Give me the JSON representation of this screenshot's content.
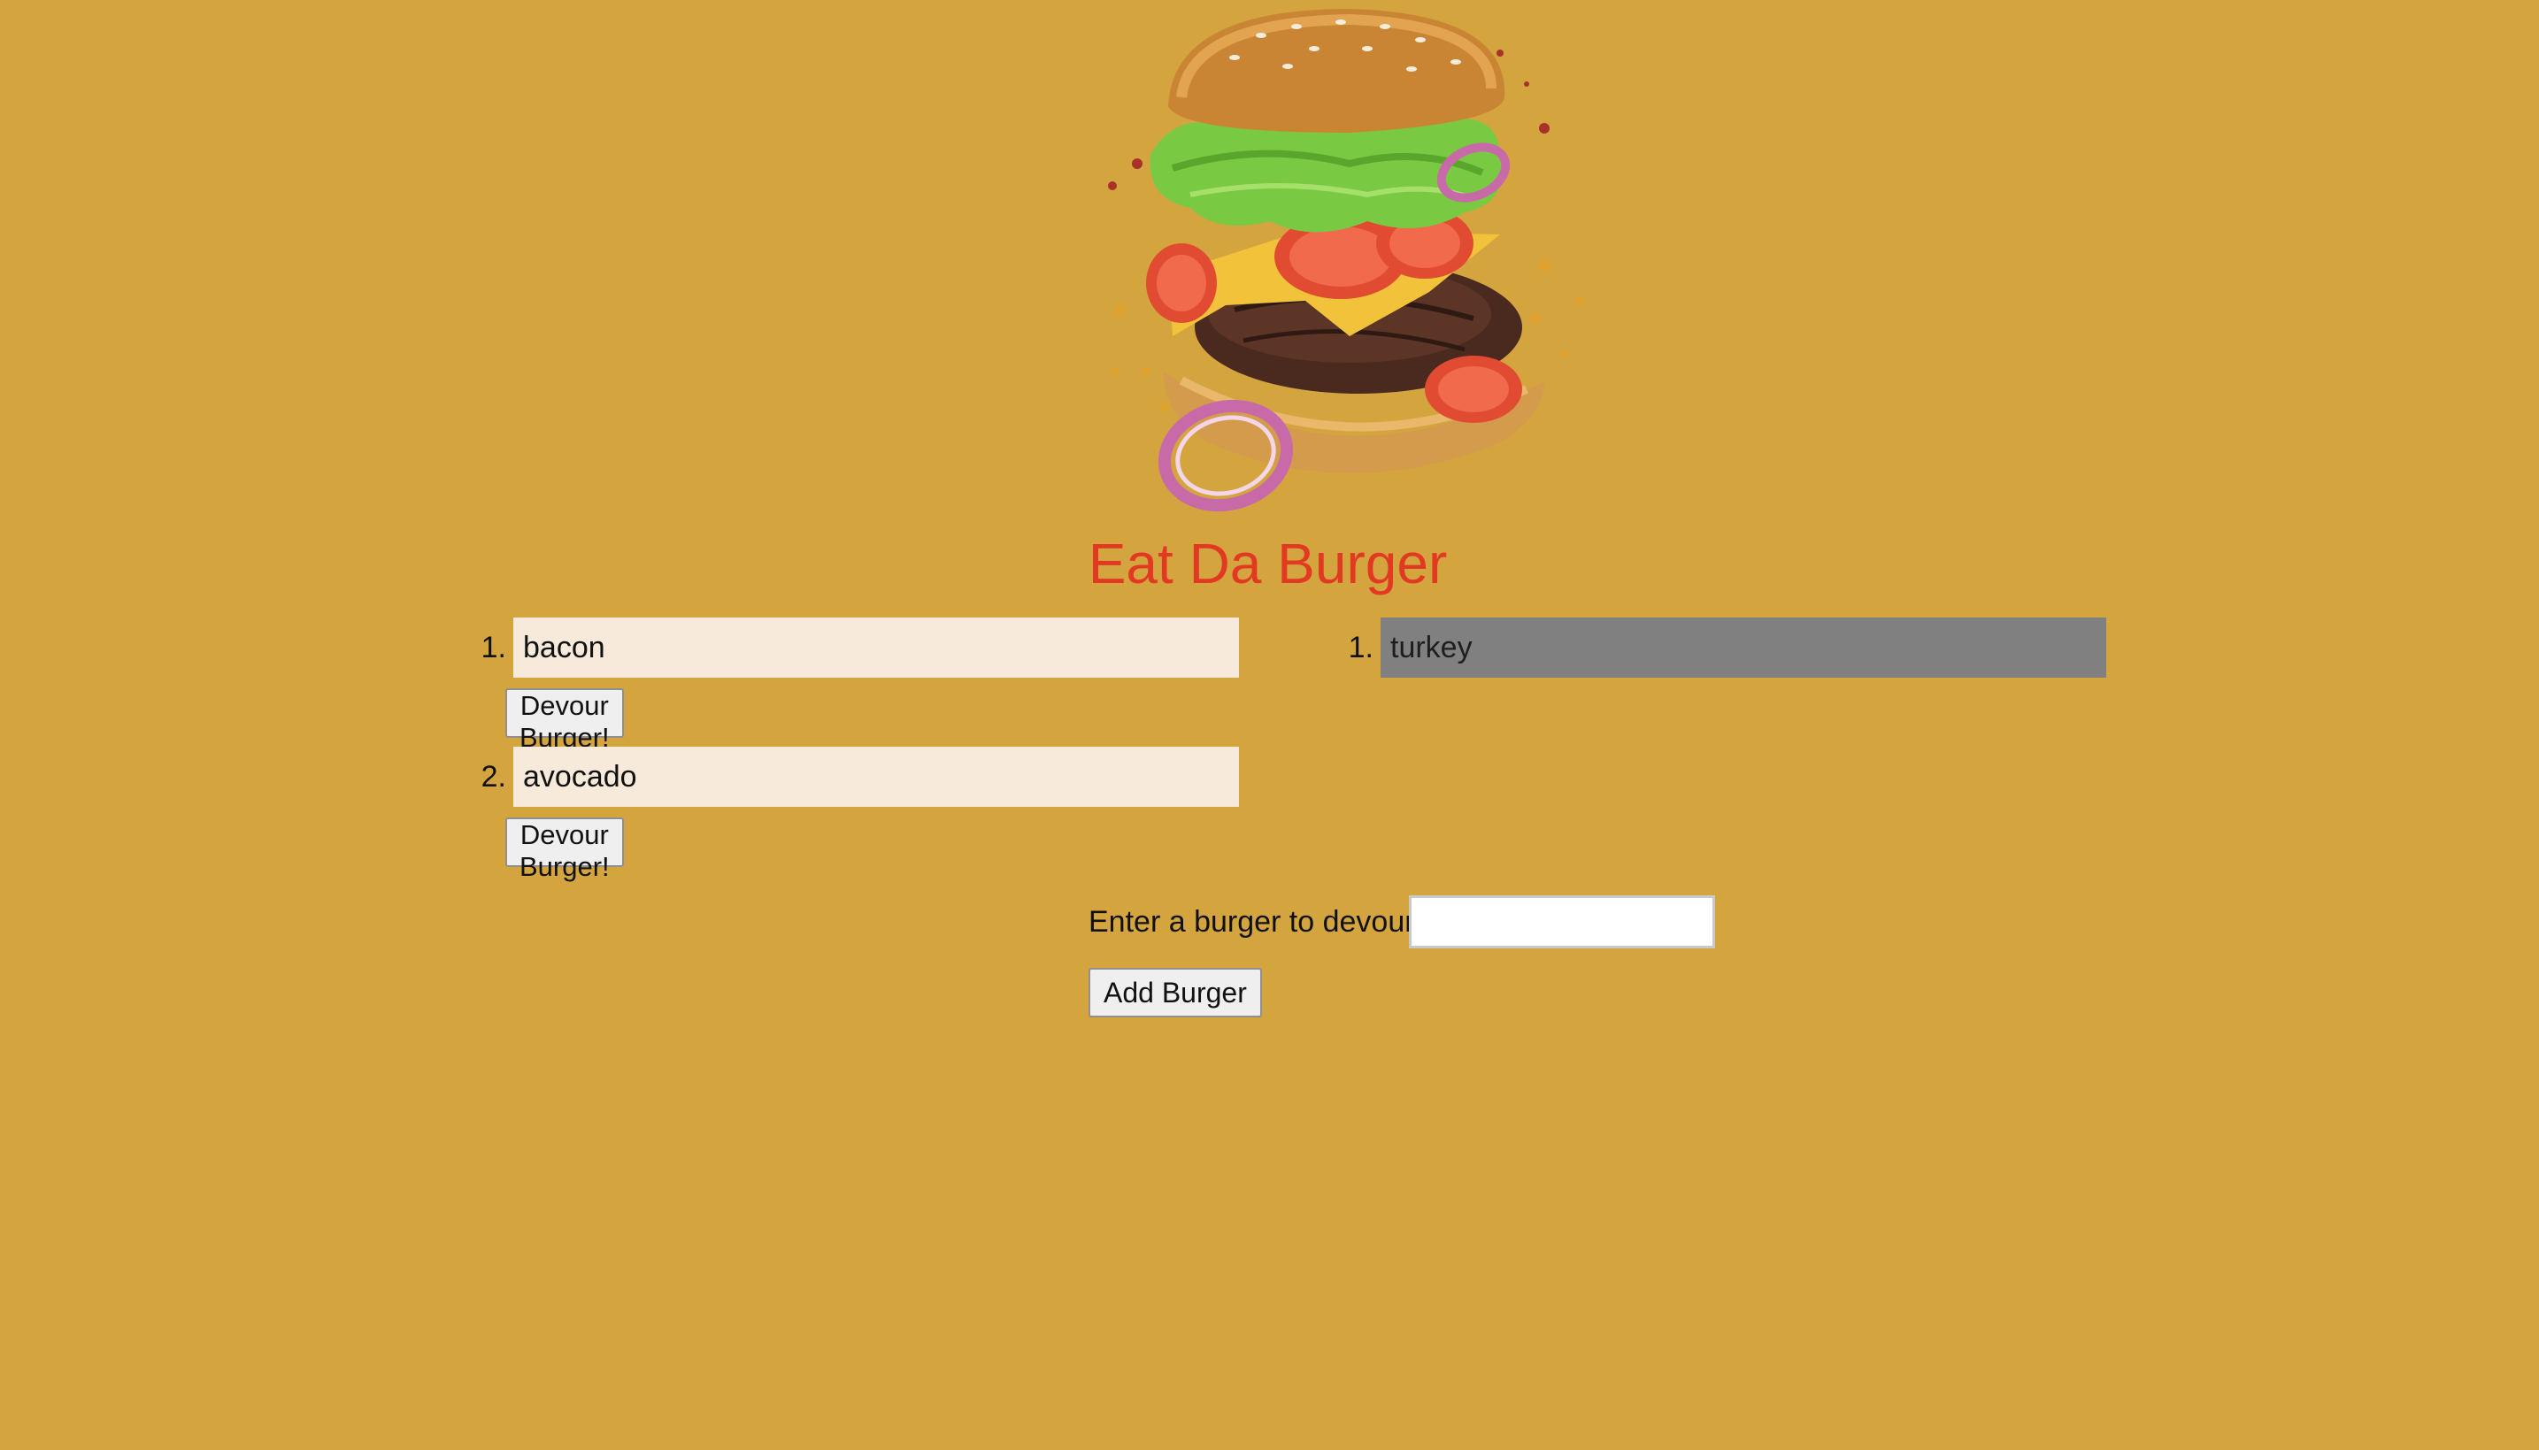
{
  "header": {
    "title": "Eat Da Burger",
    "hero_image": "burger-illustration"
  },
  "not_devoured": {
    "items": [
      {
        "number": "1.",
        "name": "bacon",
        "button_label": "Devour Burger!"
      },
      {
        "number": "2.",
        "name": "avocado",
        "button_label": "Devour Burger!"
      }
    ]
  },
  "devoured": {
    "items": [
      {
        "number": "1.",
        "name": "turkey"
      }
    ]
  },
  "form": {
    "label": "Enter a burger to devour",
    "input_value": "",
    "input_placeholder": "",
    "submit_label": "Add Burger"
  },
  "colors": {
    "background": "#d4a53f",
    "title": "#e23a22",
    "pending_item_bg": "#f7eadb",
    "devoured_item_bg": "#808080"
  }
}
